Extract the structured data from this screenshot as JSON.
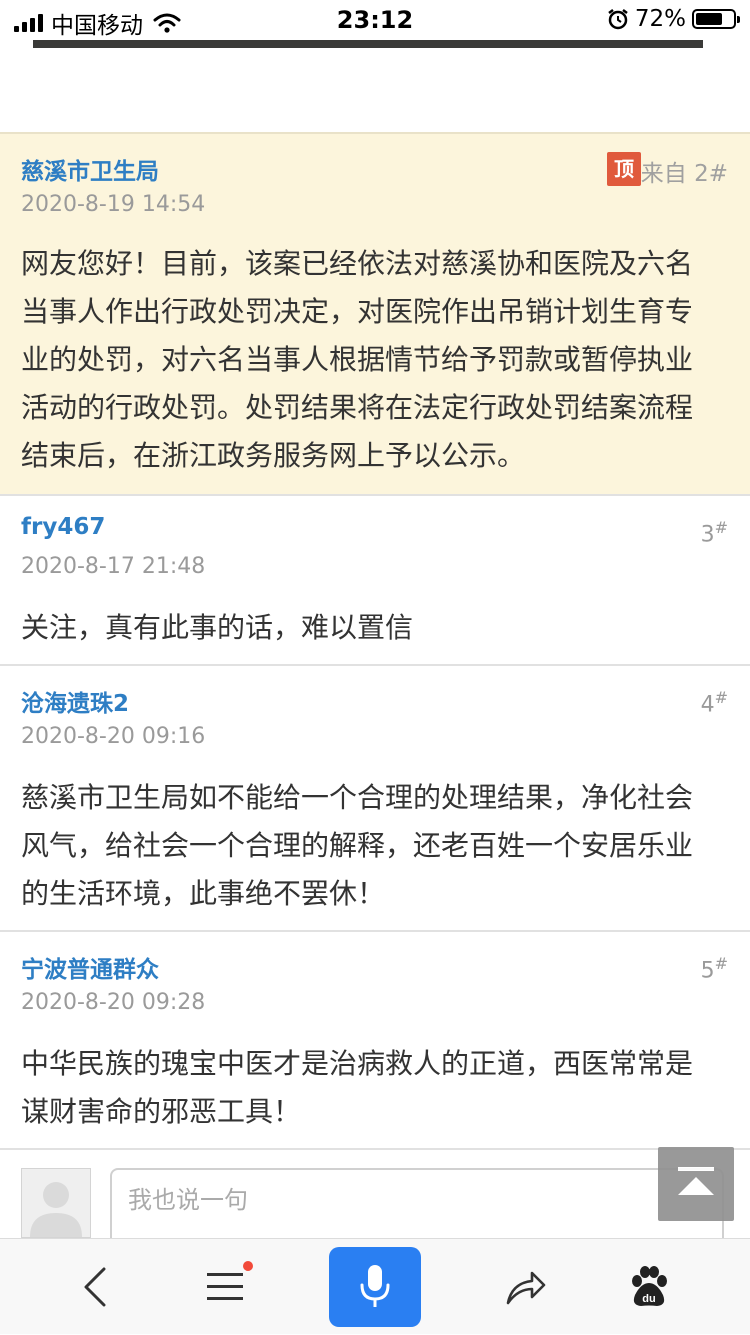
{
  "status_bar": {
    "carrier": "中国移动",
    "time": "23:12",
    "battery_percent": "72%",
    "battery_level": 0.72
  },
  "posts": [
    {
      "author": "慈溪市卫生局",
      "date": "2020-8-19 14:54",
      "badge": "顶",
      "from_label": "来自 2#",
      "content": "网友您好！目前，该案已经依法对慈溪协和医院及六名当事人作出行政处罚决定，对医院作出吊销计划生育专业的处罚，对六名当事人根据情节给予罚款或暂停执业活动的行政处罚。处罚结果将在法定行政处罚结案流程结束后，在浙江政务服务网上予以公示。"
    },
    {
      "author": "fry467",
      "date": "2020-8-17 21:48",
      "floor": "3",
      "floor_mark": "#",
      "content": "关注，真有此事的话，难以置信"
    },
    {
      "author": "沧海遗珠2",
      "date": "2020-8-20 09:16",
      "floor": "4",
      "floor_mark": "#",
      "content": "慈溪市卫生局如不能给一个合理的处理结果，净化社会风气，给社会一个合理的解释，还老百姓一个安居乐业的生活环境，此事绝不罢休！"
    },
    {
      "author": "宁波普通群众",
      "date": "2020-8-20 09:28",
      "floor": "5",
      "floor_mark": "#",
      "content": "中华民族的瑰宝中医才是治病救人的正道，西医常常是谋财害命的邪恶工具！"
    }
  ],
  "reply": {
    "placeholder": "我也说一句"
  },
  "icons": {
    "back": "back-arrow-icon",
    "menu": "menu-icon",
    "mic": "microphone-icon",
    "share": "share-icon",
    "brand": "baidu-paw-icon",
    "totop": "scroll-to-top-icon"
  },
  "colors": {
    "author_link": "#2e7ec4",
    "highlight_bg": "#fcf5dc",
    "mic_button": "#2a7ff2",
    "badge": "#e05a3c",
    "notification_dot": "#f24a3a"
  }
}
